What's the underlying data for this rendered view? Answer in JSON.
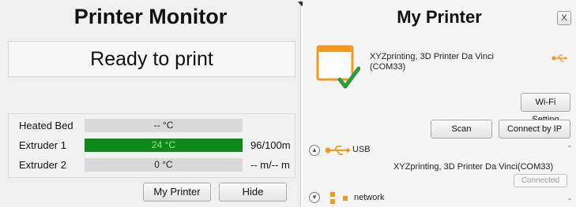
{
  "monitor": {
    "title": "Printer Monitor",
    "status": "Ready to print",
    "readings": [
      {
        "label": "Heated Bed",
        "value": "-- °C",
        "progress": 0,
        "extra": ""
      },
      {
        "label": "Extruder 1",
        "value": "24 °C",
        "progress": 1.0,
        "extra": "96/100m"
      },
      {
        "label": "Extruder 2",
        "value": "0 °C",
        "progress": 0,
        "extra": "-- m/-- m"
      }
    ],
    "buttons": {
      "my_printer": "My Printer",
      "hide": "Hide"
    }
  },
  "my_printer": {
    "title": "My Printer",
    "close_label": "X",
    "printer_name": "XYZprinting, 3D Printer Da Vinci (COM33)",
    "buttons": {
      "wifi": "Wi-Fi Setting",
      "scan": "Scan",
      "connect_ip": "Connect by IP"
    },
    "usb": {
      "label": "USB",
      "device": "XYZprinting, 3D Printer Da Vinci(COM33)",
      "status": "Connected"
    },
    "network": {
      "label": "network"
    }
  },
  "colors": {
    "accent_orange": "#f29a1f",
    "progress_green": "#0f8a1a",
    "check_green": "#2a9d3a"
  },
  "icons": [
    "printer-icon",
    "usb-icon",
    "network-icon",
    "close-icon",
    "expand-icon"
  ]
}
